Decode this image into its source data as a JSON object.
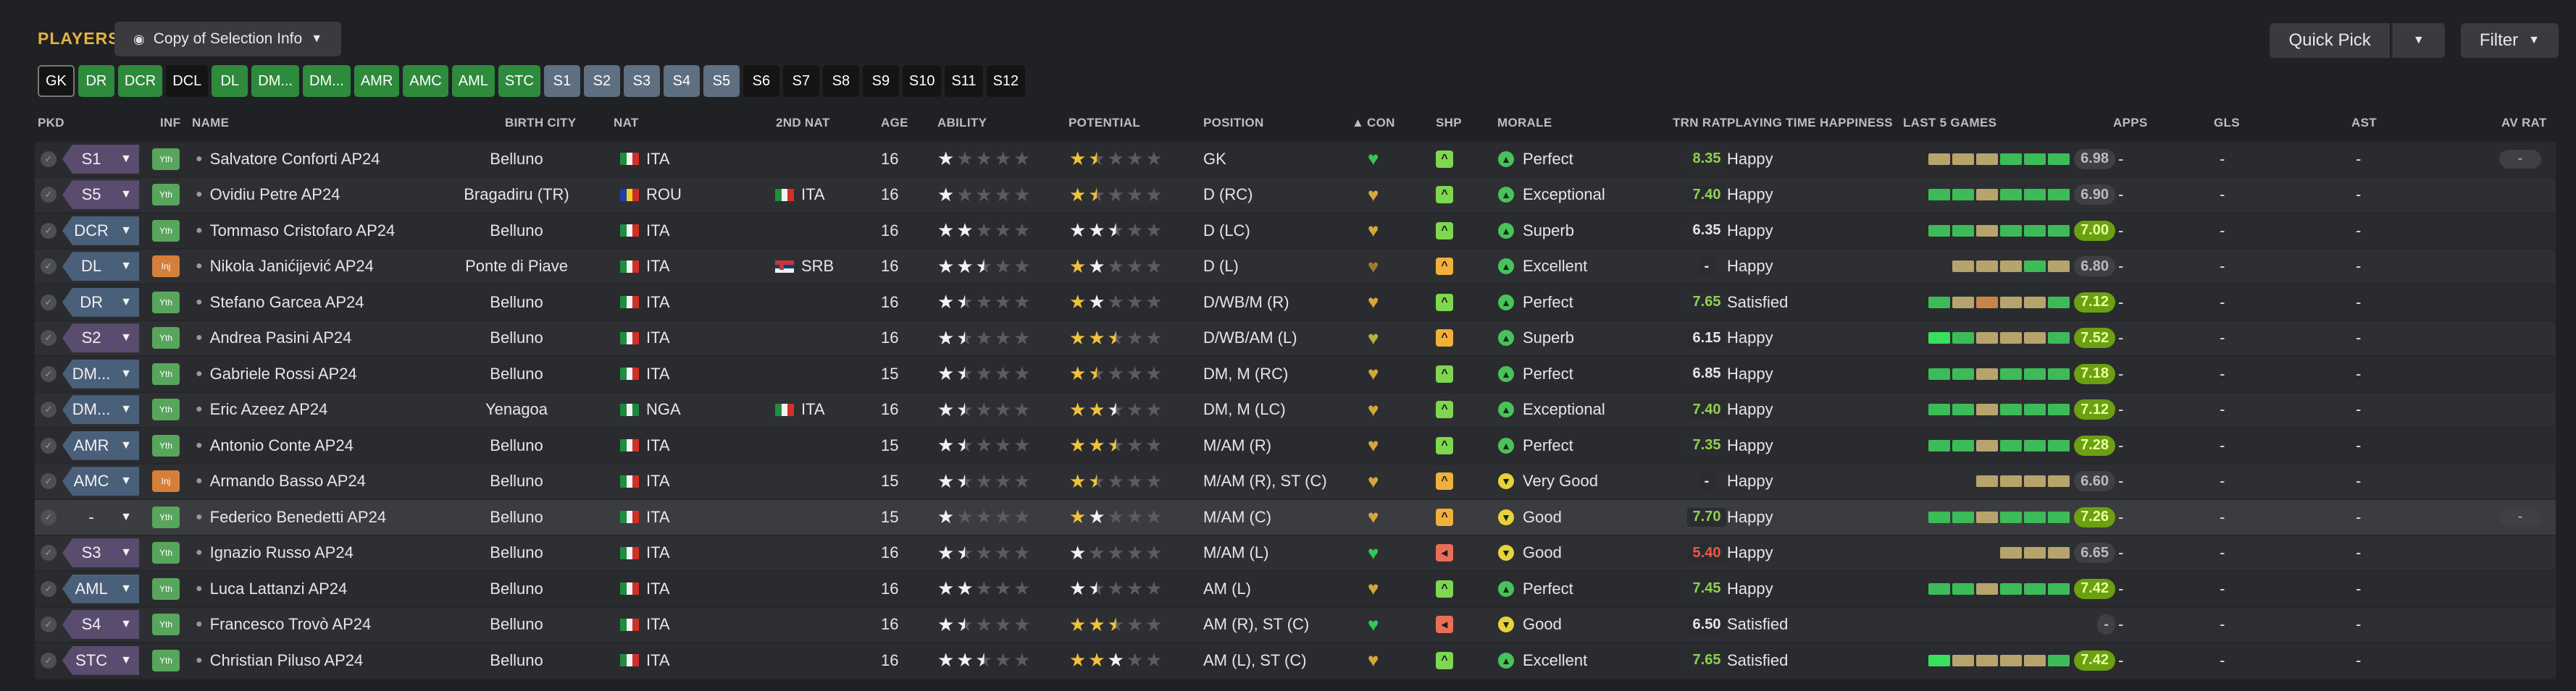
{
  "header": {
    "title": "PLAYERS",
    "view_label": "Copy of Selection Info",
    "quick_pick": "Quick Pick",
    "filter": "Filter"
  },
  "chips": [
    {
      "label": "GK",
      "style": "gk"
    },
    {
      "label": "DR",
      "style": "green"
    },
    {
      "label": "DCR",
      "style": "green"
    },
    {
      "label": "DCL",
      "style": "black"
    },
    {
      "label": "DL",
      "style": "green"
    },
    {
      "label": "DM...",
      "style": "green"
    },
    {
      "label": "DM...",
      "style": "green"
    },
    {
      "label": "AMR",
      "style": "green"
    },
    {
      "label": "AMC",
      "style": "green"
    },
    {
      "label": "AML",
      "style": "green"
    },
    {
      "label": "STC",
      "style": "green"
    },
    {
      "label": "S1",
      "style": "blue"
    },
    {
      "label": "S2",
      "style": "blue"
    },
    {
      "label": "S3",
      "style": "blue"
    },
    {
      "label": "S4",
      "style": "blue"
    },
    {
      "label": "S5",
      "style": "blue"
    },
    {
      "label": "S6",
      "style": "black"
    },
    {
      "label": "S7",
      "style": "black"
    },
    {
      "label": "S8",
      "style": "black"
    },
    {
      "label": "S9",
      "style": "black"
    },
    {
      "label": "S10",
      "style": "black"
    },
    {
      "label": "S11",
      "style": "black"
    },
    {
      "label": "S12",
      "style": "black"
    }
  ],
  "columns": {
    "pkd": "PKD",
    "inf": "INF",
    "name": "NAME",
    "birth_city": "BIRTH CITY",
    "nat": "NAT",
    "nat2": "2ND NAT",
    "age": "AGE",
    "ability": "ABILITY",
    "potential": "POTENTIAL",
    "position": "POSITION",
    "con": "CON",
    "shp": "SHP",
    "morale": "MORALE",
    "trn_rat": "TRN RAT",
    "pth": "PLAYING TIME HAPPINESS",
    "last5": "LAST 5 GAMES",
    "apps": "APPS",
    "gls": "GLS",
    "ast": "AST",
    "av_rat": "AV RAT"
  },
  "colors": {
    "accent": "#e3b341",
    "green": "#2e8b3c",
    "trn_green": "#8fd14f",
    "trn_red": "#e85b4a",
    "trn_white": "#e6e6e6",
    "heart_green": "#34c759",
    "heart_gold": "#d4a73a",
    "heart_dim": "#9e7a2d",
    "heart_olive": "#b0b53a",
    "shp_green": "#7fd650",
    "shp_amber": "#f0b03a",
    "shp_red": "#ea6d57",
    "mor_green": "#49c25a",
    "mor_yellow": "#e8d23a",
    "bar_green": "#3dbb58",
    "bar_tan": "#b7a46c",
    "bar_orange": "#c98548",
    "bar_brightgreen": "#38e05b"
  },
  "rows": [
    {
      "pkd": "S1",
      "pkd_style": "purple",
      "inf": "Yth",
      "name": "Salvatore Conforti AP24",
      "birth_city": "Belluno",
      "flag": "ita",
      "nat": "ITA",
      "flag2": "",
      "nat2": "",
      "age": "16",
      "ability": 1,
      "potential": 1.5,
      "potential_gold": 1.5,
      "position": "GK",
      "con": "green",
      "shp": "green",
      "morale_icon": "green",
      "morale": "Perfect",
      "trn": "8.35",
      "trn_color": "green",
      "pth": "Happy",
      "last5": [
        "tan",
        "tan",
        "tan",
        "green",
        "green",
        "green"
      ],
      "avg": "6.98",
      "avg_style": "grey",
      "apps": "-",
      "gls": "-",
      "ast": "-",
      "avrat": "-"
    },
    {
      "pkd": "S5",
      "pkd_style": "purple",
      "inf": "Yth",
      "name": "Ovidiu Petre AP24",
      "birth_city": "Bragadiru (TR)",
      "flag": "rou",
      "nat": "ROU",
      "flag2": "ita",
      "nat2": "ITA",
      "age": "16",
      "ability": 1,
      "potential": 1.5,
      "potential_gold": 1.5,
      "position": "D (RC)",
      "con": "gold",
      "shp": "green",
      "morale_icon": "green",
      "morale": "Exceptional",
      "trn": "7.40",
      "trn_color": "green",
      "pth": "Happy",
      "last5": [
        "green",
        "green",
        "tan",
        "green",
        "green",
        "green"
      ],
      "avg": "6.90",
      "avg_style": "grey",
      "apps": "-",
      "gls": "-",
      "ast": "-",
      "avrat": "-"
    },
    {
      "pkd": "DCR",
      "pkd_style": "blue",
      "inf": "Yth",
      "name": "Tommaso Cristofaro AP24",
      "birth_city": "Belluno",
      "flag": "ita",
      "nat": "ITA",
      "flag2": "",
      "nat2": "",
      "age": "16",
      "ability": 2,
      "potential": 2.5,
      "potential_gold": 0,
      "position": "D (LC)",
      "con": "gold",
      "shp": "green",
      "morale_icon": "green",
      "morale": "Superb",
      "trn": "6.35",
      "trn_color": "white",
      "pth": "Happy",
      "last5": [
        "green",
        "green",
        "tan",
        "green",
        "green",
        "green"
      ],
      "avg": "7.00",
      "avg_style": "green",
      "apps": "-",
      "gls": "-",
      "ast": "-",
      "avrat": "-"
    },
    {
      "pkd": "DL",
      "pkd_style": "blue",
      "inf": "Inj",
      "name": "Nikola Janićijević AP24",
      "birth_city": "Ponte di Piave",
      "flag": "ita",
      "nat": "ITA",
      "flag2": "srb",
      "nat2": "SRB",
      "age": "16",
      "ability": 2.5,
      "potential": 2,
      "potential_gold": 1,
      "position": "D (L)",
      "con": "dim",
      "shp": "amber",
      "morale_icon": "green",
      "morale": "Excellent",
      "trn": "-",
      "trn_color": "white",
      "pth": "Happy",
      "last5": [
        "",
        "tan",
        "tan",
        "tan",
        "green",
        "tan"
      ],
      "avg": "6.80",
      "avg_style": "grey",
      "apps": "-",
      "gls": "-",
      "ast": "-",
      "avrat": "-"
    },
    {
      "pkd": "DR",
      "pkd_style": "blue",
      "inf": "Yth",
      "name": "Stefano Garcea AP24",
      "birth_city": "Belluno",
      "flag": "ita",
      "nat": "ITA",
      "flag2": "",
      "nat2": "",
      "age": "16",
      "ability": 1.5,
      "potential": 2,
      "potential_gold": 1,
      "position": "D/WB/M (R)",
      "con": "gold",
      "shp": "green",
      "morale_icon": "green",
      "morale": "Perfect",
      "trn": "7.65",
      "trn_color": "green",
      "pth": "Satisfied",
      "last5": [
        "green",
        "tan",
        "orange",
        "tan",
        "tan",
        "green"
      ],
      "avg": "7.12",
      "avg_style": "green",
      "apps": "-",
      "gls": "-",
      "ast": "-",
      "avrat": "-"
    },
    {
      "pkd": "S2",
      "pkd_style": "purple",
      "inf": "Yth",
      "name": "Andrea Pasini AP24",
      "birth_city": "Belluno",
      "flag": "ita",
      "nat": "ITA",
      "flag2": "",
      "nat2": "",
      "age": "16",
      "ability": 1.5,
      "potential": 2.5,
      "potential_gold": 2.5,
      "position": "D/WB/AM (L)",
      "con": "olive",
      "shp": "amber",
      "morale_icon": "green",
      "morale": "Superb",
      "trn": "6.15",
      "trn_color": "white",
      "pth": "Happy",
      "last5": [
        "bright",
        "green",
        "tan",
        "tan",
        "tan",
        "green"
      ],
      "avg": "7.52",
      "avg_style": "green",
      "apps": "-",
      "gls": "-",
      "ast": "-",
      "avrat": "-"
    },
    {
      "pkd": "DM...",
      "pkd_style": "blue",
      "inf": "Yth",
      "name": "Gabriele Rossi AP24",
      "birth_city": "Belluno",
      "flag": "ita",
      "nat": "ITA",
      "flag2": "",
      "nat2": "",
      "age": "15",
      "ability": 1.5,
      "potential": 1.5,
      "potential_gold": 1.5,
      "position": "DM, M (RC)",
      "con": "gold",
      "shp": "green",
      "morale_icon": "green",
      "morale": "Perfect",
      "trn": "6.85",
      "trn_color": "white",
      "pth": "Happy",
      "last5": [
        "green",
        "green",
        "tan",
        "green",
        "green",
        "green"
      ],
      "avg": "7.18",
      "avg_style": "green",
      "apps": "-",
      "gls": "-",
      "ast": "-",
      "avrat": "-"
    },
    {
      "pkd": "DM...",
      "pkd_style": "blue",
      "inf": "Yth",
      "name": "Eric Azeez AP24",
      "birth_city": "Yenagoa",
      "flag": "nga",
      "nat": "NGA",
      "flag2": "ita",
      "nat2": "ITA",
      "age": "16",
      "ability": 1.5,
      "potential": 2.5,
      "potential_gold": 1.5,
      "position": "DM, M (LC)",
      "con": "gold",
      "shp": "green",
      "morale_icon": "green",
      "morale": "Exceptional",
      "trn": "7.40",
      "trn_color": "green",
      "pth": "Happy",
      "last5": [
        "green",
        "green",
        "tan",
        "green",
        "green",
        "green"
      ],
      "avg": "7.12",
      "avg_style": "green",
      "apps": "-",
      "gls": "-",
      "ast": "-",
      "avrat": "-"
    },
    {
      "pkd": "AMR",
      "pkd_style": "blue",
      "inf": "Yth",
      "name": "Antonio Conte AP24",
      "birth_city": "Belluno",
      "flag": "ita",
      "nat": "ITA",
      "flag2": "",
      "nat2": "",
      "age": "15",
      "ability": 1.5,
      "potential": 2.5,
      "potential_gold": 2.5,
      "position": "M/AM (R)",
      "con": "gold",
      "shp": "green",
      "morale_icon": "green",
      "morale": "Perfect",
      "trn": "7.35",
      "trn_color": "green",
      "pth": "Happy",
      "last5": [
        "green",
        "green",
        "tan",
        "green",
        "green",
        "green"
      ],
      "avg": "7.28",
      "avg_style": "green",
      "apps": "-",
      "gls": "-",
      "ast": "-",
      "avrat": "-"
    },
    {
      "pkd": "AMC",
      "pkd_style": "blue",
      "inf": "Inj",
      "name": "Armando Basso AP24",
      "birth_city": "Belluno",
      "flag": "ita",
      "nat": "ITA",
      "flag2": "",
      "nat2": "",
      "age": "15",
      "ability": 1.5,
      "potential": 1.5,
      "potential_gold": 1.5,
      "position": "M/AM (R), ST (C)",
      "con": "gold",
      "shp": "amber",
      "morale_icon": "yellow",
      "morale": "Very Good",
      "trn": "-",
      "trn_color": "white",
      "pth": "Happy",
      "last5": [
        "",
        "",
        "tan",
        "tan",
        "tan",
        "tan"
      ],
      "avg": "6.60",
      "avg_style": "grey",
      "apps": "-",
      "gls": "-",
      "ast": "-",
      "avrat": "-"
    },
    {
      "pkd": "-",
      "pkd_style": "plain",
      "inf": "Yth",
      "name": "Federico Benedetti AP24",
      "birth_city": "Belluno",
      "flag": "ita",
      "nat": "ITA",
      "flag2": "",
      "nat2": "",
      "age": "15",
      "ability": 1,
      "potential": 2,
      "potential_gold": 1,
      "position": "M/AM (C)",
      "con": "gold",
      "shp": "amber",
      "morale_icon": "yellow",
      "morale": "Good",
      "trn": "7.70",
      "trn_color": "green",
      "pth": "Happy",
      "last5": [
        "green",
        "green",
        "tan",
        "green",
        "green",
        "green"
      ],
      "avg": "7.26",
      "avg_style": "green",
      "apps": "-",
      "gls": "-",
      "ast": "-",
      "avrat": "-"
    },
    {
      "pkd": "S3",
      "pkd_style": "purple",
      "inf": "Yth",
      "name": "Ignazio Russo AP24",
      "birth_city": "Belluno",
      "flag": "ita",
      "nat": "ITA",
      "flag2": "",
      "nat2": "",
      "age": "16",
      "ability": 1.5,
      "potential": 1,
      "potential_gold": 0,
      "position": "M/AM (L)",
      "con": "green",
      "shp": "red",
      "morale_icon": "yellow",
      "morale": "Good",
      "trn": "5.40",
      "trn_color": "red",
      "pth": "Happy",
      "last5": [
        "",
        "",
        "",
        "tan",
        "tan",
        "tan"
      ],
      "avg": "6.65",
      "avg_style": "grey",
      "apps": "-",
      "gls": "-",
      "ast": "-",
      "avrat": "-"
    },
    {
      "pkd": "AML",
      "pkd_style": "blue",
      "inf": "Yth",
      "name": "Luca Lattanzi AP24",
      "birth_city": "Belluno",
      "flag": "ita",
      "nat": "ITA",
      "flag2": "",
      "nat2": "",
      "age": "16",
      "ability": 2,
      "potential": 1.5,
      "potential_gold": 0,
      "position": "AM (L)",
      "con": "gold",
      "shp": "green",
      "morale_icon": "green",
      "morale": "Perfect",
      "trn": "7.45",
      "trn_color": "green",
      "pth": "Happy",
      "last5": [
        "green",
        "green",
        "tan",
        "green",
        "green",
        "green"
      ],
      "avg": "7.42",
      "avg_style": "green",
      "apps": "-",
      "gls": "-",
      "ast": "-",
      "avrat": "-"
    },
    {
      "pkd": "S4",
      "pkd_style": "purple",
      "inf": "Yth",
      "name": "Francesco Trovò AP24",
      "birth_city": "Belluno",
      "flag": "ita",
      "nat": "ITA",
      "flag2": "",
      "nat2": "",
      "age": "16",
      "ability": 1.5,
      "potential": 2.5,
      "potential_gold": 2.5,
      "position": "AM (R), ST (C)",
      "con": "green",
      "shp": "red",
      "morale_icon": "yellow",
      "morale": "Good",
      "trn": "6.50",
      "trn_color": "white",
      "pth": "Satisfied",
      "last5": [],
      "avg": "-",
      "avg_style": "grey",
      "apps": "-",
      "gls": "-",
      "ast": "-",
      "avrat": "-"
    },
    {
      "pkd": "STC",
      "pkd_style": "purple",
      "inf": "Yth",
      "name": "Christian Piluso AP24",
      "birth_city": "Belluno",
      "flag": "ita",
      "nat": "ITA",
      "flag2": "",
      "nat2": "",
      "age": "16",
      "ability": 2.5,
      "potential": 3,
      "potential_gold": 2,
      "position": "AM (L), ST (C)",
      "con": "gold",
      "shp": "green",
      "morale_icon": "green",
      "morale": "Excellent",
      "trn": "7.65",
      "trn_color": "green",
      "pth": "Satisfied",
      "last5": [
        "bright",
        "tan",
        "tan",
        "tan",
        "tan",
        "green"
      ],
      "avg": "7.42",
      "avg_style": "green",
      "apps": "-",
      "gls": "-",
      "ast": "-",
      "avrat": "-"
    }
  ]
}
